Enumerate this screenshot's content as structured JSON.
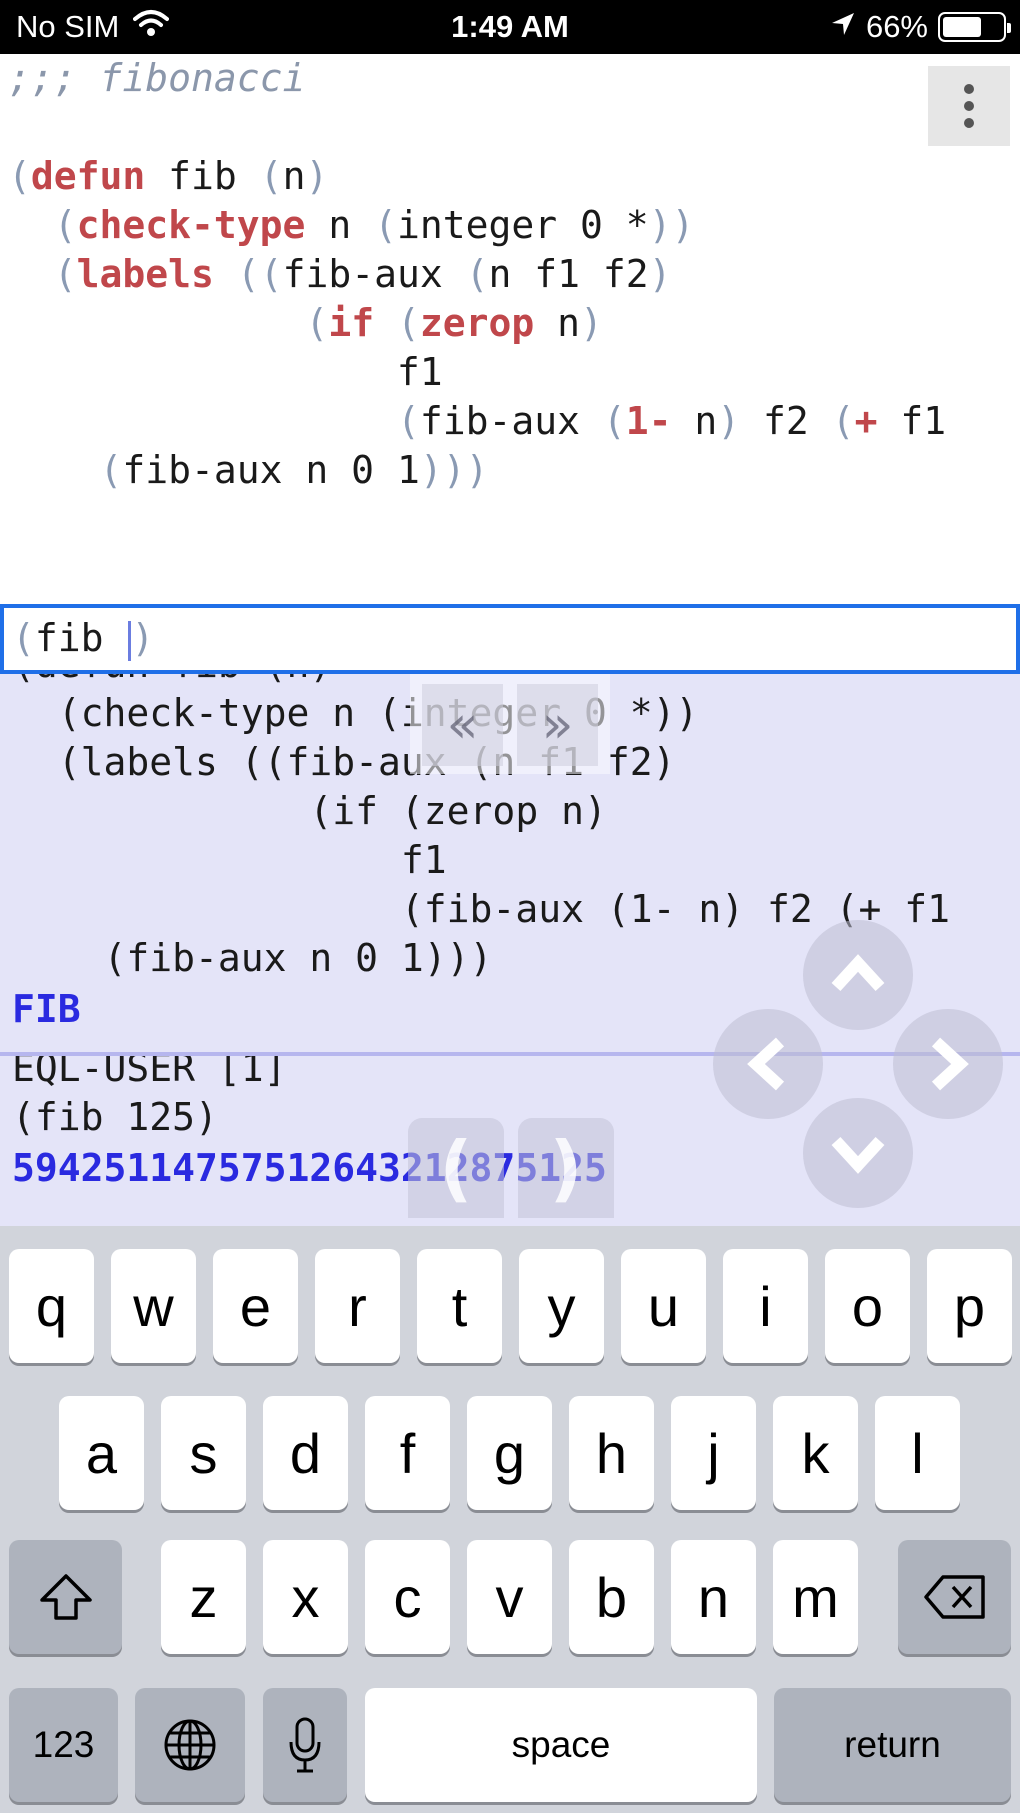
{
  "status_bar": {
    "carrier": "No SIM",
    "time": "1:49 AM",
    "battery_percent": "66%",
    "battery_level": 0.66
  },
  "editor": {
    "lines": [
      [
        {
          "t": ";;; fibonacci",
          "c": "cmt"
        }
      ],
      [],
      [
        {
          "t": "(",
          "c": "p"
        },
        {
          "t": "defun",
          "c": "kw"
        },
        {
          "t": " fib ",
          "c": ""
        },
        {
          "t": "(",
          "c": "p"
        },
        {
          "t": "n",
          "c": ""
        },
        {
          "t": ")",
          "c": "p"
        }
      ],
      [
        {
          "t": "  ",
          "c": ""
        },
        {
          "t": "(",
          "c": "p"
        },
        {
          "t": "check-type",
          "c": "kw"
        },
        {
          "t": " n ",
          "c": ""
        },
        {
          "t": "(",
          "c": "p"
        },
        {
          "t": "integer 0 *",
          "c": ""
        },
        {
          "t": "))",
          "c": "p"
        }
      ],
      [
        {
          "t": "  ",
          "c": ""
        },
        {
          "t": "(",
          "c": "p"
        },
        {
          "t": "labels",
          "c": "kw"
        },
        {
          "t": " ",
          "c": ""
        },
        {
          "t": "((",
          "c": "p"
        },
        {
          "t": "fib-aux ",
          "c": ""
        },
        {
          "t": "(",
          "c": "p"
        },
        {
          "t": "n f1 f2",
          "c": ""
        },
        {
          "t": ")",
          "c": "p"
        }
      ],
      [
        {
          "t": "             ",
          "c": ""
        },
        {
          "t": "(",
          "c": "p"
        },
        {
          "t": "if",
          "c": "kw"
        },
        {
          "t": " ",
          "c": ""
        },
        {
          "t": "(",
          "c": "p"
        },
        {
          "t": "zerop",
          "c": "kw"
        },
        {
          "t": " n",
          "c": ""
        },
        {
          "t": ")",
          "c": "p"
        }
      ],
      [
        {
          "t": "                 f1",
          "c": ""
        }
      ],
      [
        {
          "t": "                 ",
          "c": ""
        },
        {
          "t": "(",
          "c": "p"
        },
        {
          "t": "fib-aux ",
          "c": ""
        },
        {
          "t": "(",
          "c": "p"
        },
        {
          "t": "1-",
          "c": "kw"
        },
        {
          "t": " n",
          "c": ""
        },
        {
          "t": ")",
          "c": "p"
        },
        {
          "t": " f2 ",
          "c": ""
        },
        {
          "t": "(",
          "c": "p"
        },
        {
          "t": "+",
          "c": "kw"
        },
        {
          "t": " f1",
          "c": ""
        }
      ],
      [
        {
          "t": "    ",
          "c": ""
        },
        {
          "t": "(",
          "c": "p"
        },
        {
          "t": "fib-aux n 0 1",
          "c": ""
        },
        {
          "t": ")))",
          "c": "p"
        }
      ]
    ]
  },
  "input": {
    "open_paren": "(",
    "text": "fib ",
    "close_paren": ")"
  },
  "output": {
    "echo_lines": [
      "(defun fib (n)",
      "  (check-type n (integer 0 *))",
      "  (labels ((fib-aux (n f1 f2)",
      "             (if (zerop n)",
      "                 f1",
      "                 (fib-aux (1- n) f2 (+ f1",
      "    (fib-aux n 0 1)))"
    ],
    "result_1": "FIB",
    "prompt": "EQL-USER [1]",
    "command": "(fib 125)",
    "result_2": "59425114757512643212875125"
  },
  "controls": {
    "history_back": "«",
    "history_forward": "»",
    "open_paren": "(",
    "close_paren": ")"
  },
  "keyboard": {
    "row1": [
      "q",
      "w",
      "e",
      "r",
      "t",
      "y",
      "u",
      "i",
      "o",
      "p"
    ],
    "row2": [
      "a",
      "s",
      "d",
      "f",
      "g",
      "h",
      "j",
      "k",
      "l"
    ],
    "row3": [
      "z",
      "x",
      "c",
      "v",
      "b",
      "n",
      "m"
    ],
    "numbers_label": "123",
    "space_label": "space",
    "return_label": "return"
  }
}
